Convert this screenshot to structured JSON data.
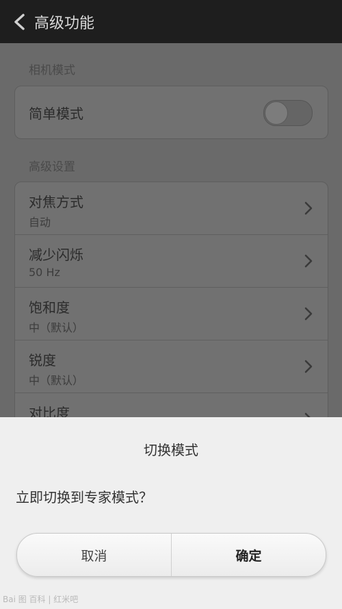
{
  "header": {
    "title": "高级功能"
  },
  "camera_section": {
    "label": "相机模式",
    "simple_mode": {
      "label": "简单模式",
      "enabled": false
    }
  },
  "advanced_section": {
    "label": "高级设置",
    "items": [
      {
        "title": "对焦方式",
        "value": "自动"
      },
      {
        "title": "减少闪烁",
        "value": "50 Hz"
      },
      {
        "title": "饱和度",
        "value": "中（默认）"
      },
      {
        "title": "锐度",
        "value": "中（默认）"
      },
      {
        "title": "对比度",
        "value": ""
      }
    ]
  },
  "dialog": {
    "title": "切换模式",
    "message": "立即切换到专家模式？",
    "cancel_label": "取消",
    "confirm_label": "确定"
  },
  "watermark": {
    "text": "Bai 图 百科 | 红米吧"
  }
}
